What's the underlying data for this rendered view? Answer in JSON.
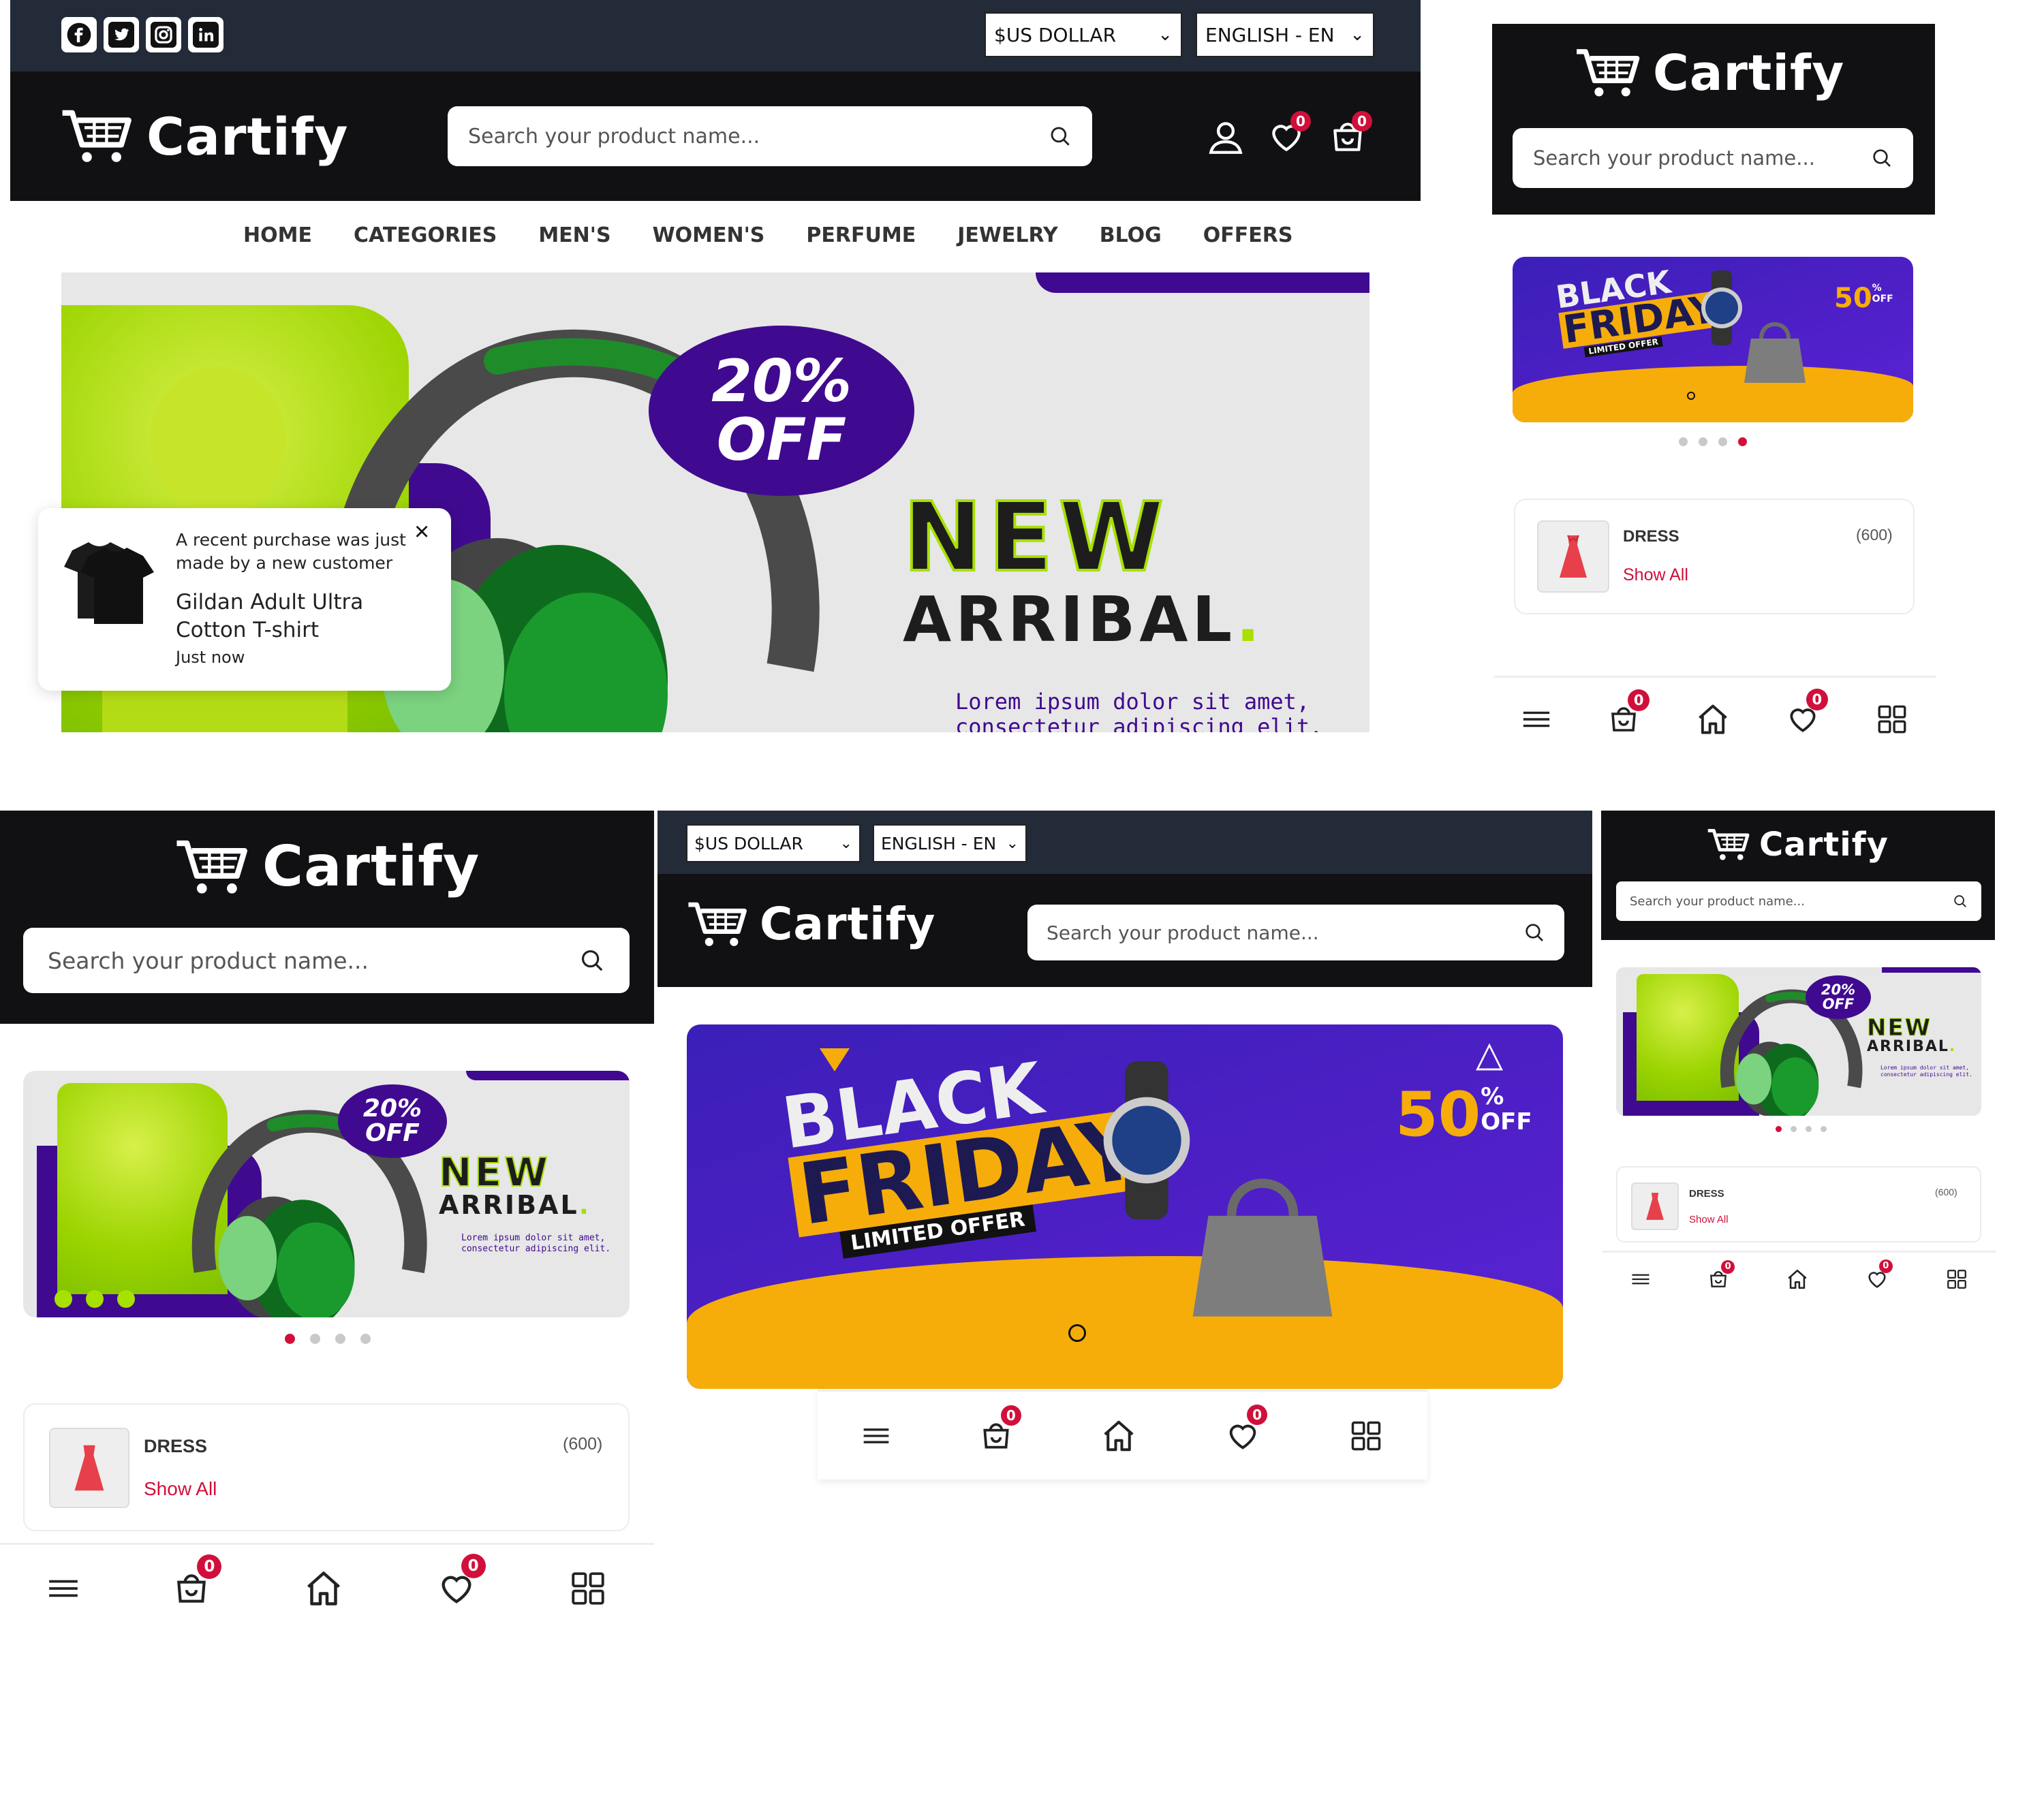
{
  "brand": "Cartify",
  "search_placeholder": "Search your product name...",
  "currency": "$US DOLLAR",
  "language": "ENGLISH - EN",
  "social": [
    "facebook-icon",
    "twitter-icon",
    "instagram-icon",
    "linkedin-icon"
  ],
  "counts": {
    "wishlist": "0",
    "cart": "0"
  },
  "menu": [
    "HOME",
    "CATEGORIES",
    "MEN'S",
    "WOMEN'S",
    "PERFUME",
    "JEWELRY",
    "BLOG",
    "OFFERS"
  ],
  "hero_new": {
    "discount": "20%",
    "off": "OFF",
    "title1": "NEW",
    "title2": "ARRIBAL",
    "dot": ".",
    "desc1": "Lorem ipsum dolor sit amet,",
    "desc2": "consectetur adipiscing elit."
  },
  "hero_bf": {
    "black": "BLACK",
    "friday": "FRIDAY",
    "limited": "LIMITED OFFER",
    "pct": "50",
    "pct_sign": "%",
    "off": "OFF"
  },
  "toast": {
    "line1": "A recent purchase was just",
    "line2": "made by a new customer",
    "product1": "Gildan Adult Ultra",
    "product2": "Cotton T-shirt",
    "time": "Just now",
    "close": "×"
  },
  "category": {
    "name": "DRESS",
    "count": "(600)",
    "link": "Show All"
  },
  "colors": {
    "dark": "#111114",
    "navy": "#232b39",
    "accent": "#d0103a",
    "purple": "#3f0a8f",
    "lime": "#a8e000",
    "orange": "#f6ad0a"
  }
}
